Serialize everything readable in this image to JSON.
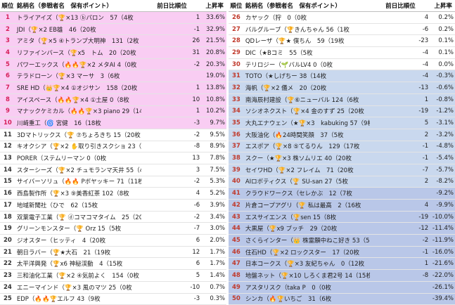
{
  "header": {
    "rank": "順位",
    "name": "銘柄名（参戦者名　保有ポイント）",
    "prev": "前日比順位",
    "up": "上昇率"
  },
  "left_rows": [
    {
      "rank": "1",
      "name": "トライアイズ（🏆×13 ⓑパロン　57（4枚",
      "prev": "1",
      "up": "33.6%",
      "band": "pink"
    },
    {
      "rank": "2",
      "name": "JDI（🏆×2 EB雄　46（20枚",
      "prev": "-1",
      "up": "32.9%",
      "band": "pink"
    },
    {
      "rank": "3",
      "name": "アミタ（🏆×5 ④トランプ大明神　131（2枚",
      "prev": "26",
      "up": "21.5%",
      "band": "pink"
    },
    {
      "rank": "4",
      "name": "リファインバース（🏆x5　トム　20（20枚",
      "prev": "31",
      "up": "20.8%",
      "band": "pink"
    },
    {
      "rank": "5",
      "name": "パワーエックス（🔥🔥🏆×2 メタAI 4（0枚",
      "prev": "-2",
      "up": "20.3%",
      "band": "pink"
    },
    {
      "rank": "6",
      "name": "テラドローン（🏆×3 マーサ　3（6枚",
      "prev": "",
      "up": "19.0%",
      "band": "pink"
    },
    {
      "rank": "7",
      "name": "SRE HD（👑🏆×4 ①オジサン　158（20枚",
      "prev": "1",
      "up": "13.8%",
      "band": "pink"
    },
    {
      "rank": "8",
      "name": "アイスペース（🔥🔥🏆×4 ①土屋 0（8枚",
      "prev": "10",
      "up": "10.8%",
      "band": "pink"
    },
    {
      "rank": "9",
      "name": "マナックケミカル（🔥🔥🏆×3 piano 29（14枚",
      "prev": "1",
      "up": "10.2%",
      "band": "pink"
    },
    {
      "rank": "10",
      "name": "川崎重工（🌀 宮健　16（18枚",
      "prev": "-3",
      "up": "9.7%",
      "band": "pink"
    },
    {
      "rank": "11",
      "name": "3Dマトリックス（🏆 ⑦ちょろきち 15（20枚",
      "prev": "-2",
      "up": "9.5%",
      "band": "white"
    },
    {
      "rank": "12",
      "name": "キオクシア（🏆×2 ✋取り引きスクショ 23（11枚",
      "prev": "-8",
      "up": "8.9%",
      "band": "white"
    },
    {
      "rank": "13",
      "name": "PORER（ステムリーマン 0（0枚",
      "prev": "13",
      "up": "7.8%",
      "band": "white"
    },
    {
      "rank": "14",
      "name": "スターシーズ（🏆×2 チュモランマ天井 55（4枚",
      "prev": "3",
      "up": "7.5%",
      "band": "white"
    },
    {
      "rank": "15",
      "name": "サイバーソリュ（🔥🔥 Pボヤッキー 71（11枚",
      "prev": "-2",
      "up": "5.3%",
      "band": "white"
    },
    {
      "rank": "16",
      "name": "西島製作所（🏆×3 ⑨美香紅茶 102（8枚",
      "prev": "4",
      "up": "5.2%",
      "band": "white"
    },
    {
      "rank": "17",
      "name": "地域新聞社（ひで　62（15枚",
      "prev": "-6",
      "up": "3.9%",
      "band": "white"
    },
    {
      "rank": "18",
      "name": "双葉電子工業（🏆 ⓓコマコマタイム　25（20枚",
      "prev": "-2",
      "up": "3.4%",
      "band": "white"
    },
    {
      "rank": "19",
      "name": "グリーンモンスター（🏆 Orz 15（5枚",
      "prev": "-7",
      "up": "3.0%",
      "band": "white"
    },
    {
      "rank": "20",
      "name": "ジオスター（ヒッティ　4（20枚",
      "prev": "6",
      "up": "2.0%",
      "band": "white"
    },
    {
      "rank": "21",
      "name": "朝日ラバー（🏆★大石　21（19枚",
      "prev": "12",
      "up": "1.7%",
      "band": "white"
    },
    {
      "rank": "22",
      "name": "太平洋興発（🏆x6 神秘渓動　4（15枚",
      "prev": "6",
      "up": "1.7%",
      "band": "white"
    },
    {
      "rank": "23",
      "name": "三和油化工業（🏆×2 ④気前よく　154（0枚",
      "prev": "5",
      "up": "1.4%",
      "band": "white"
    },
    {
      "rank": "24",
      "name": "エニーマインド（🏆×3 風のマツ 25（0枚",
      "prev": "-10",
      "up": "0.7%",
      "band": "white"
    },
    {
      "rank": "25",
      "name": "EDP（🔥🔥🏆エルフ 43（9枚",
      "prev": "-3",
      "up": "0.3%",
      "band": "white"
    }
  ],
  "right_rows": [
    {
      "rank": "26",
      "name": "カヤック（狩　0（0枚",
      "prev": "4",
      "up": "0.2%",
      "band": "plain"
    },
    {
      "rank": "27",
      "name": "バルグループ（🏆きんちゃん 56（1枚",
      "prev": "-6",
      "up": "0.2%",
      "band": "plain"
    },
    {
      "rank": "28",
      "name": "QDレーザ（🏆★ 僕ちん　59（19枚",
      "prev": "-23",
      "up": "0.1%",
      "band": "plain"
    },
    {
      "rank": "29",
      "name": "DIC（★Bコミ　55（5枚",
      "prev": "-4",
      "up": "0.1%",
      "band": "plain"
    },
    {
      "rank": "30",
      "name": "テリロジー（🌱バルLV4 0（0枚",
      "prev": "-4",
      "up": "0.0%",
      "band": "plain"
    },
    {
      "rank": "31",
      "name": "TOTO（★しげちー 38（14枚",
      "prev": "-4",
      "up": "-0.3%",
      "band": "blue1"
    },
    {
      "rank": "32",
      "name": "海帆（🏆×2 儀メ　20（20枚",
      "prev": "-13",
      "up": "-0.6%",
      "band": "blue1"
    },
    {
      "rank": "33",
      "name": "南海辰村建設（🏆⑥ニューバル 124（6枚",
      "prev": "1",
      "up": "-0.8%",
      "band": "blue1"
    },
    {
      "rank": "34",
      "name": "ソシオネクスト（🏆×4 金のすず 25（20枚",
      "prev": "-19",
      "up": "-1.2%",
      "band": "blue1"
    },
    {
      "rank": "35",
      "name": "大丸エナウェン（★🏆×3　kabuking 57（9枚",
      "prev": "5",
      "up": "-3.1%",
      "band": "blue1"
    },
    {
      "rank": "36",
      "name": "大阪油化（🔥24時間笑顔　37（5枚",
      "prev": "2",
      "up": "-3.2%",
      "band": "blue1"
    },
    {
      "rank": "37",
      "name": "エスポア（🏆×8 ⑤てるりん　129（17枚",
      "prev": "-1",
      "up": "-4.8%",
      "band": "blue1"
    },
    {
      "rank": "38",
      "name": "スクー（★🏆×3 株ソムリエ 40（20枚",
      "prev": "-1",
      "up": "-5.4%",
      "band": "blue1"
    },
    {
      "rank": "39",
      "name": "セイワHD（🏆×2 フレイム　71（20枚",
      "prev": "-7",
      "up": "-5.7%",
      "band": "blue1"
    },
    {
      "rank": "40",
      "name": "AIロボティクス（🏆 SU-san 27（5枚",
      "prev": "2",
      "up": "-8.2%",
      "band": "blue1"
    },
    {
      "rank": "41",
      "name": "クラウドワークス（セレかぶ　12（7枚",
      "prev": "",
      "up": "-9.2%",
      "band": "blue2"
    },
    {
      "rank": "42",
      "name": "片倉コープアグリ（🏆 私は最高　2（16枚",
      "prev": "4",
      "up": "-9.9%",
      "band": "blue2"
    },
    {
      "rank": "43",
      "name": "エスサイエンス（🏆sen 15（8枚",
      "prev": "-19",
      "up": "-10.0%",
      "band": "blue2"
    },
    {
      "rank": "44",
      "name": "大黒屋（🏆x9 ブッチ　29（20枚",
      "prev": "-12",
      "up": "-11.4%",
      "band": "blue2"
    },
    {
      "rank": "45",
      "name": "さくらインター（👑 株霊願中ねこ好き 53（5枚",
      "prev": "-2",
      "up": "-11.9%",
      "band": "blue2"
    },
    {
      "rank": "46",
      "name": "住石HD（🏆×2 ロックスター　17（20枚",
      "prev": "-1",
      "up": "-16.0%",
      "band": "blue2"
    },
    {
      "rank": "47",
      "name": "日本コークス（🏆×3 友紀ちゃん　0（12枚",
      "prev": "1",
      "up": "-21.6%",
      "band": "blue2"
    },
    {
      "rank": "48",
      "name": "地盤ネット（🏆×10 しろくま君2号 14（15枚",
      "prev": "-8",
      "up": "-22.0%",
      "band": "blue2"
    },
    {
      "rank": "49",
      "name": "アスタリスク（taka P　0（0枚",
      "prev": "",
      "up": "-26.1%",
      "band": "blue2"
    },
    {
      "rank": "50",
      "name": "シンカ（🔥🏆いちご　31（6枚",
      "prev": "",
      "up": "-39.4%",
      "band": "blue2"
    }
  ]
}
